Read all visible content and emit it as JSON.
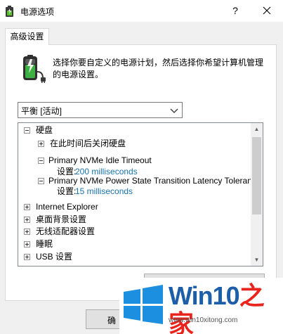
{
  "window": {
    "title": "电源选项",
    "help_label": "?"
  },
  "tab": {
    "label": "高级设置"
  },
  "description": "选择你要自定义的电源计划，然后选择你希望计算机管理的电源设置。",
  "plan_select": {
    "value": "平衡 [活动]"
  },
  "tree": {
    "items": [
      {
        "type": "category",
        "label": "硬盘",
        "expanded": true
      },
      {
        "type": "sub",
        "label": "在此时间后关闭硬盘",
        "expanded": false
      },
      {
        "type": "sub",
        "label": "Primary NVMe Idle Timeout",
        "expanded": true
      },
      {
        "type": "setting",
        "label": "设置:",
        "value": "200 milliseconds"
      },
      {
        "type": "sub",
        "label": "Primary NVMe Power State Transition Latency Tolerance",
        "expanded": true
      },
      {
        "type": "setting",
        "label": "设置:",
        "value": "15 milliseconds"
      },
      {
        "type": "category",
        "label": "Internet Explorer",
        "expanded": false
      },
      {
        "type": "category",
        "label": "桌面背景设置",
        "expanded": false
      },
      {
        "type": "category",
        "label": "无线适配器设置",
        "expanded": false
      },
      {
        "type": "category",
        "label": "睡眠",
        "expanded": false
      },
      {
        "type": "category",
        "label": "USB 设置",
        "expanded": false
      }
    ]
  },
  "buttons": {
    "ok_visible_label": "确"
  },
  "watermark": {
    "title_en": "Win10",
    "title_zh": "之家",
    "url": "www.win10xitong.com"
  },
  "colors": {
    "setting_value": "#1a73a8",
    "watermark_blue": "#1d5ea8",
    "watermark_red": "#e8241c",
    "battery_green": "#3cb043"
  },
  "icons": {
    "app": "power-options-icon",
    "battery": "battery-plug-icon",
    "dropdown": "chevron-down-icon",
    "close": "close-icon",
    "logo": "windows-logo-icon"
  }
}
